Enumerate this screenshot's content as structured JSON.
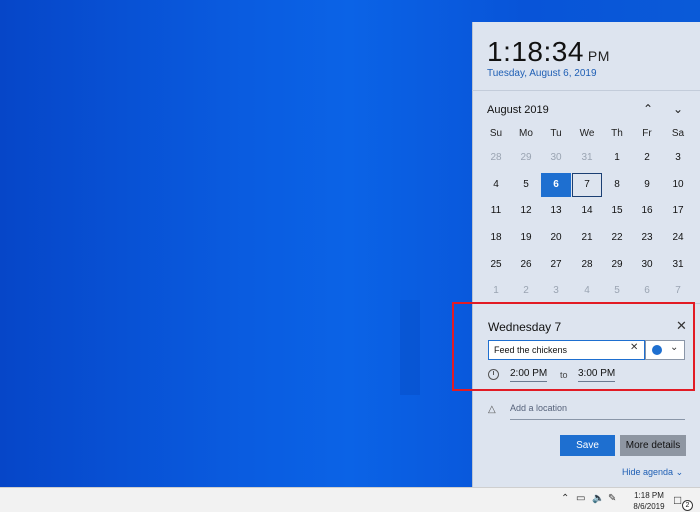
{
  "clock": {
    "time": "1:18:34",
    "ampm": "PM",
    "date": "Tuesday, August 6, 2019"
  },
  "calendar": {
    "month_label": "August 2019",
    "weekdays": [
      "Su",
      "Mo",
      "Tu",
      "We",
      "Th",
      "Fr",
      "Sa"
    ],
    "weeks": [
      [
        "28",
        "29",
        "30",
        "31",
        "1",
        "2",
        "3"
      ],
      [
        "4",
        "5",
        "6",
        "7",
        "8",
        "9",
        "10"
      ],
      [
        "11",
        "12",
        "13",
        "14",
        "15",
        "16",
        "17"
      ],
      [
        "18",
        "19",
        "20",
        "21",
        "22",
        "23",
        "24"
      ],
      [
        "25",
        "26",
        "27",
        "28",
        "29",
        "30",
        "31"
      ],
      [
        "1",
        "2",
        "3",
        "4",
        "5",
        "6",
        "7"
      ]
    ],
    "selected_day": "6",
    "focused_day": "7"
  },
  "event": {
    "day_title": "Wednesday 7",
    "title_value": "Feed the chickens",
    "color": "#1e6fd0",
    "start_time": "2:00 PM",
    "to_label": "to",
    "end_time": "3:00 PM",
    "location_placeholder": "Add a location",
    "save_label": "Save",
    "more_label": "More details",
    "hide_agenda_label": "Hide agenda"
  },
  "taskbar": {
    "time": "1:18 PM",
    "date": "8/6/2019",
    "notification_count": "2"
  },
  "colors": {
    "accent": "#1e6fd0",
    "highlight": "#e21b24"
  }
}
